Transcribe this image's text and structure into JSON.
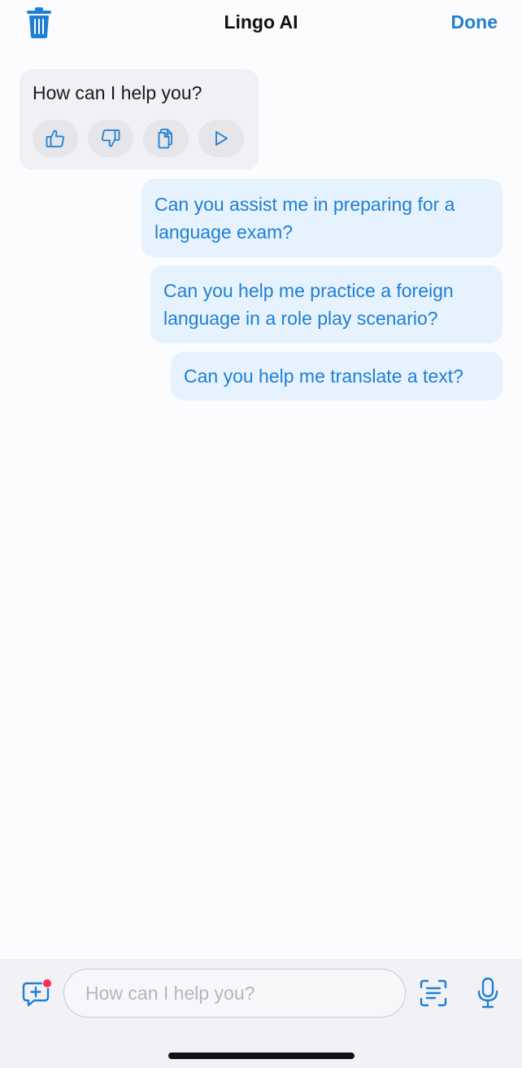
{
  "header": {
    "title": "Lingo AI",
    "done_label": "Done",
    "trash_icon": "trash-icon"
  },
  "messages": {
    "bot": {
      "text": "How can I help you?",
      "actions": [
        "thumbs-up-icon",
        "thumbs-down-icon",
        "copy-icon",
        "play-icon"
      ]
    },
    "user": [
      "Can you assist me in preparing for a language exam?",
      "Can you help me practice a foreign language in a role play scenario?",
      "Can you help me translate a text?"
    ]
  },
  "input_bar": {
    "placeholder": "How can I help you?",
    "value": "",
    "icons": [
      "new-chat-icon",
      "scan-text-icon",
      "microphone-icon"
    ]
  },
  "colors": {
    "accent": "#1f7fd4",
    "user_bubble": "#e6f2fd",
    "bot_bubble": "#f1f1f5",
    "badge": "#ff2d55"
  }
}
